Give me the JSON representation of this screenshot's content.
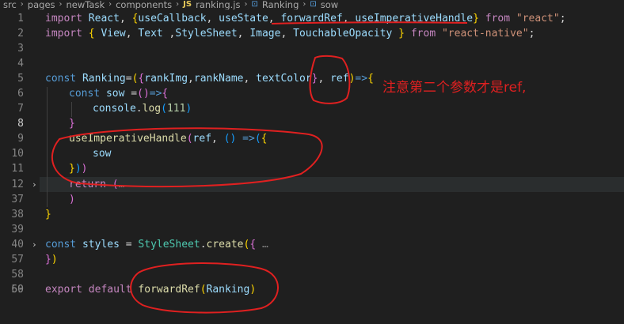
{
  "breadcrumb": {
    "items": [
      "src",
      "pages",
      "newTask",
      "components",
      "ranking.js",
      "Ranking",
      "sow"
    ],
    "file_badge": "JS"
  },
  "editor": {
    "active_line": 8,
    "line_numbers": [
      "1",
      "2",
      "3",
      "4",
      "5",
      "6",
      "7",
      "8",
      "9",
      "10",
      "11",
      "12",
      "37",
      "38",
      "39",
      "40",
      "57",
      "58",
      "59",
      "60"
    ],
    "lines": {
      "l1": [
        [
          "import ",
          "kc"
        ],
        [
          "React",
          "v"
        ],
        [
          ", ",
          "p"
        ],
        [
          "{",
          "b1"
        ],
        [
          "useCallback",
          "v"
        ],
        [
          ", ",
          "p"
        ],
        [
          "useState",
          "v"
        ],
        [
          ", ",
          "p"
        ],
        [
          "forwardRef",
          "v"
        ],
        [
          ", ",
          "p"
        ],
        [
          "useImperativeHandle",
          "v"
        ],
        [
          "}",
          "b1"
        ],
        [
          " from ",
          "kc"
        ],
        [
          "\"react\"",
          "s"
        ],
        [
          ";",
          "p"
        ]
      ],
      "l2": [
        [
          "import ",
          "kc"
        ],
        [
          "{ ",
          "b1"
        ],
        [
          "View",
          "v"
        ],
        [
          ", ",
          "p"
        ],
        [
          "Text",
          "v"
        ],
        [
          " ,",
          "p"
        ],
        [
          "StyleSheet",
          "v"
        ],
        [
          ", ",
          "p"
        ],
        [
          "Image",
          "v"
        ],
        [
          ", ",
          "p"
        ],
        [
          "TouchableOpacity",
          "v"
        ],
        [
          " }",
          "b1"
        ],
        [
          " from ",
          "kc"
        ],
        [
          "\"react-native\"",
          "s"
        ],
        [
          ";",
          "p"
        ]
      ],
      "l5": [
        [
          "const ",
          "k"
        ],
        [
          "Ranking",
          "v"
        ],
        [
          "=",
          "p"
        ],
        [
          "(",
          "b1"
        ],
        [
          "{",
          "b2"
        ],
        [
          "rankImg",
          "v"
        ],
        [
          ",",
          "p"
        ],
        [
          "rankName",
          "v"
        ],
        [
          ", ",
          "p"
        ],
        [
          "textColor",
          "v"
        ],
        [
          "}",
          "b2"
        ],
        [
          ", ",
          "p"
        ],
        [
          "ref",
          "v"
        ],
        [
          ")",
          "b1"
        ],
        [
          "=>",
          "k"
        ],
        [
          "{",
          "b1"
        ]
      ],
      "l6": [
        [
          "const ",
          "k"
        ],
        [
          "sow",
          "v"
        ],
        [
          " =",
          "p"
        ],
        [
          "(",
          "b2"
        ],
        [
          ")",
          "b2"
        ],
        [
          "=>",
          "k"
        ],
        [
          "{",
          "b2"
        ]
      ],
      "l7": [
        [
          "console",
          "v"
        ],
        [
          ".",
          "p"
        ],
        [
          "log",
          "f"
        ],
        [
          "(",
          "b3"
        ],
        [
          "111",
          "n"
        ],
        [
          ")",
          "b3"
        ]
      ],
      "l8": [
        [
          "}",
          "b2"
        ]
      ],
      "l9": [
        [
          "useImperativeHandle",
          "f"
        ],
        [
          "(",
          "b2"
        ],
        [
          "ref",
          "v"
        ],
        [
          ", ",
          "p"
        ],
        [
          "(",
          "b3"
        ],
        [
          ")",
          "b3"
        ],
        [
          " =>",
          "k"
        ],
        [
          "(",
          "b3"
        ],
        [
          "{",
          "b1"
        ]
      ],
      "l10": [
        [
          "sow",
          "v"
        ]
      ],
      "l11": [
        [
          "}",
          "b1"
        ],
        [
          ")",
          "b3"
        ],
        [
          ")",
          "b2"
        ]
      ],
      "l12": [
        [
          "return ",
          "kc"
        ],
        [
          "(",
          "b2"
        ],
        [
          "…",
          "dim"
        ]
      ],
      "l37": [
        [
          ")",
          "b2"
        ]
      ],
      "l38": [
        [
          "}",
          "b1"
        ]
      ],
      "l40": [
        [
          "const ",
          "k"
        ],
        [
          "styles",
          "v"
        ],
        [
          " = ",
          "p"
        ],
        [
          "StyleSheet",
          "t"
        ],
        [
          ".",
          "p"
        ],
        [
          "create",
          "f"
        ],
        [
          "(",
          "b1"
        ],
        [
          "{",
          "b2"
        ],
        [
          " …",
          "dim"
        ]
      ],
      "l57": [
        [
          "}",
          "b2"
        ],
        [
          ")",
          "b1"
        ]
      ],
      "l60": [
        [
          "export ",
          "kc"
        ],
        [
          "default ",
          "kc"
        ],
        [
          "forwardRef",
          "f"
        ],
        [
          "(",
          "b1"
        ],
        [
          "Ranking",
          "v"
        ],
        [
          ")",
          "b1"
        ]
      ]
    }
  },
  "annotation": {
    "text": "注意第二个参数才是ref,",
    "color": "#e02020"
  }
}
